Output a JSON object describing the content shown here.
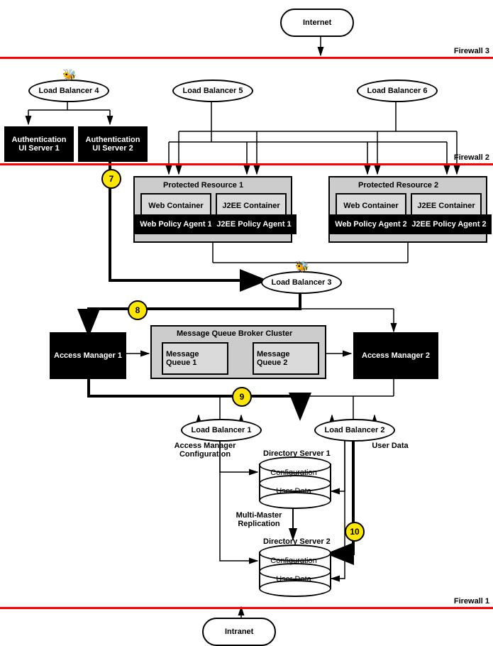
{
  "clouds": {
    "internet": "Internet",
    "intranet": "Intranet"
  },
  "firewalls": {
    "f3": "Firewall 3",
    "f2": "Firewall 2",
    "f1": "Firewall 1"
  },
  "lb": {
    "lb1": "Load Balancer 1",
    "lb2": "Load Balancer 2",
    "lb3": "Load Balancer 3",
    "lb4": "Load Balancer 4",
    "lb5": "Load Balancer 5",
    "lb6": "Load Balancer 6"
  },
  "auth": {
    "a1": "Authentication UI Server  1",
    "a2": "Authentication UI  Server 2"
  },
  "protected": {
    "p1": {
      "title": "Protected Resource  1",
      "web": "Web Container",
      "j2ee": "J2EE Container",
      "wpa": "Web Policy Agent 1",
      "jpa": "J2EE Policy Agent 1"
    },
    "p2": {
      "title": "Protected Resource  2",
      "web": "Web Container",
      "j2ee": "J2EE Container",
      "wpa": "Web Policy Agent 2",
      "jpa": "J2EE Policy Agent 2"
    }
  },
  "am": {
    "am1": "Access Manager 1",
    "am2": "Access Manager 2"
  },
  "mq": {
    "title": "Message Queue Broker Cluster",
    "q1": "Message\nQueue 1",
    "q2": "Message\nQueue 2"
  },
  "ds": {
    "ds1": "Directory Server 1",
    "ds2": "Directory Server 2",
    "cfg": "Configuration",
    "ud": "User Data"
  },
  "labels": {
    "amcfg": "Access Manager\nConfiguration",
    "userdata": "User Data",
    "mmr": "Multi-Master\nReplication"
  },
  "markers": {
    "m7": "7",
    "m8": "8",
    "m9": "9",
    "m10": "10"
  }
}
